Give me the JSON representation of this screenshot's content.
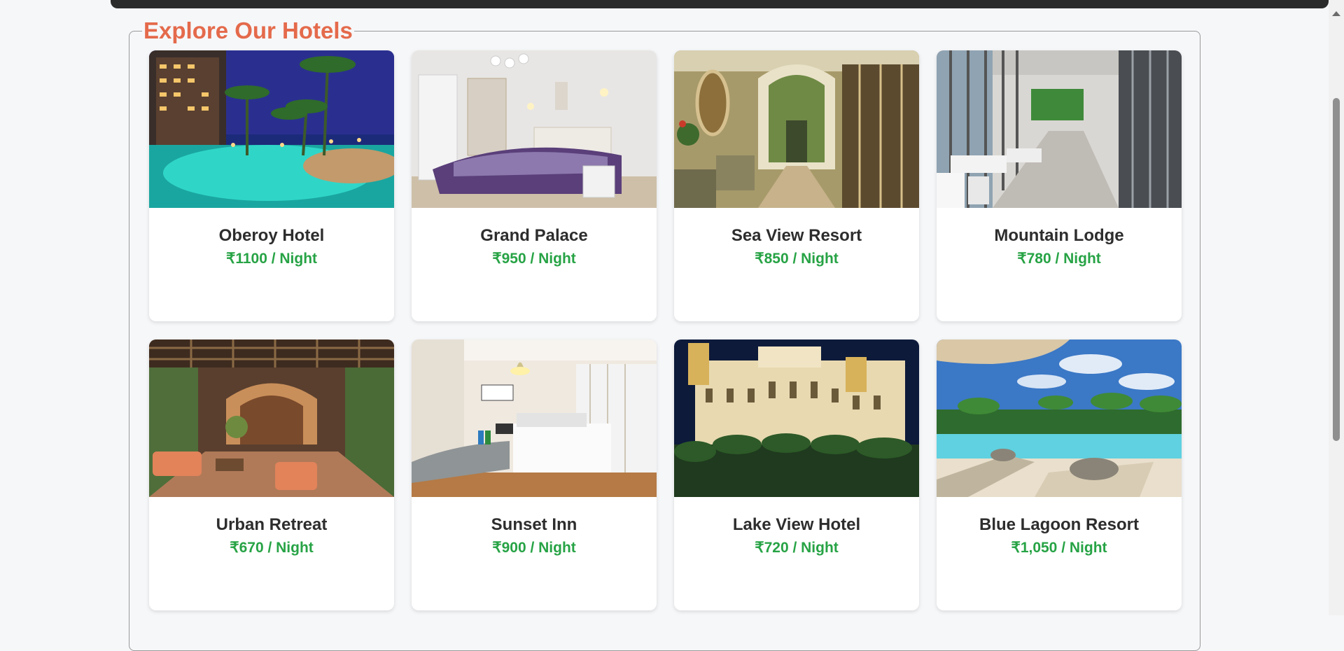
{
  "section": {
    "title": "Explore Our Hotels"
  },
  "hotels": [
    {
      "name": "Oberoy Hotel",
      "price": "₹1100 / Night",
      "image": "resort-pool-night-photo"
    },
    {
      "name": "Grand Palace",
      "price": "₹950 / Night",
      "image": "bedroom-photo"
    },
    {
      "name": "Sea View Resort",
      "price": "₹850 / Night",
      "image": "lobby-corridor-photo"
    },
    {
      "name": "Mountain Lodge",
      "price": "₹780 / Night",
      "image": "lounge-hall-photo"
    },
    {
      "name": "Urban Retreat",
      "price": "₹670 / Night",
      "image": "ornate-atrium-photo"
    },
    {
      "name": "Sunset Inn",
      "price": "₹900 / Night",
      "image": "modern-room-photo"
    },
    {
      "name": "Lake View Hotel",
      "price": "₹720 / Night",
      "image": "palace-night-photo"
    },
    {
      "name": "Blue Lagoon Resort",
      "price": "₹1,050 / Night",
      "image": "beach-pool-photo"
    }
  ],
  "colors": {
    "title": "#e46a4b",
    "price": "#27a345",
    "hotel_name": "#2d2d2d"
  }
}
